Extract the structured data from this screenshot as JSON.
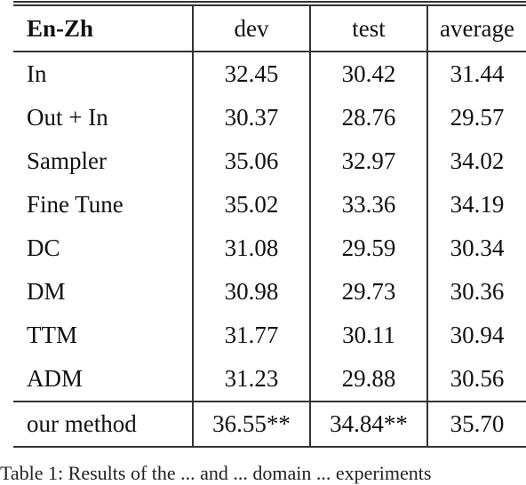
{
  "table": {
    "header": [
      "En-Zh",
      "dev",
      "test",
      "average"
    ],
    "rows": [
      [
        "In",
        "32.45",
        "30.42",
        "31.44"
      ],
      [
        "Out + In",
        "30.37",
        "28.76",
        "29.57"
      ],
      [
        "Sampler",
        "35.06",
        "32.97",
        "34.02"
      ],
      [
        "Fine Tune",
        "35.02",
        "33.36",
        "34.19"
      ],
      [
        "DC",
        "31.08",
        "29.59",
        "30.34"
      ],
      [
        "DM",
        "30.98",
        "29.73",
        "30.36"
      ],
      [
        "TTM",
        "31.77",
        "30.11",
        "30.94"
      ],
      [
        "ADM",
        "31.23",
        "29.88",
        "30.56"
      ]
    ],
    "final_row": [
      "our method",
      "36.55**",
      "34.84**",
      "35.70"
    ]
  },
  "caption": "Table 1: Results of the ... and ... domain ... experiments"
}
